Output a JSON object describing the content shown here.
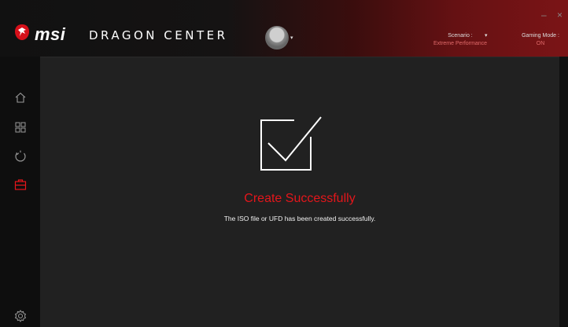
{
  "window": {
    "minimize_icon": "–",
    "close_icon": "×"
  },
  "header": {
    "brand": "msi",
    "product": "DRAGON CENTER",
    "avatar_caret": "▾",
    "scenario": {
      "label": "Scenario :",
      "value": "Extreme Performance",
      "caret": "▾"
    },
    "gaming_mode": {
      "label": "Gaming Mode :",
      "value": "ON"
    }
  },
  "sidebar": {
    "items": [
      {
        "icon": "home-icon",
        "active": false
      },
      {
        "icon": "apps-grid-icon",
        "active": false
      },
      {
        "icon": "eco-refresh-icon",
        "active": false
      },
      {
        "icon": "toolbox-icon",
        "active": true
      },
      {
        "icon": "settings-gear-icon",
        "active": false
      }
    ]
  },
  "main": {
    "status_icon": "checkbox-check-icon",
    "title": "Create Successfully",
    "message": "The ISO file or UFD has been created successfully."
  },
  "colors": {
    "accent": "#e5161b",
    "panel_bg": "#212121",
    "sidebar_bg": "#0e0e0e"
  }
}
